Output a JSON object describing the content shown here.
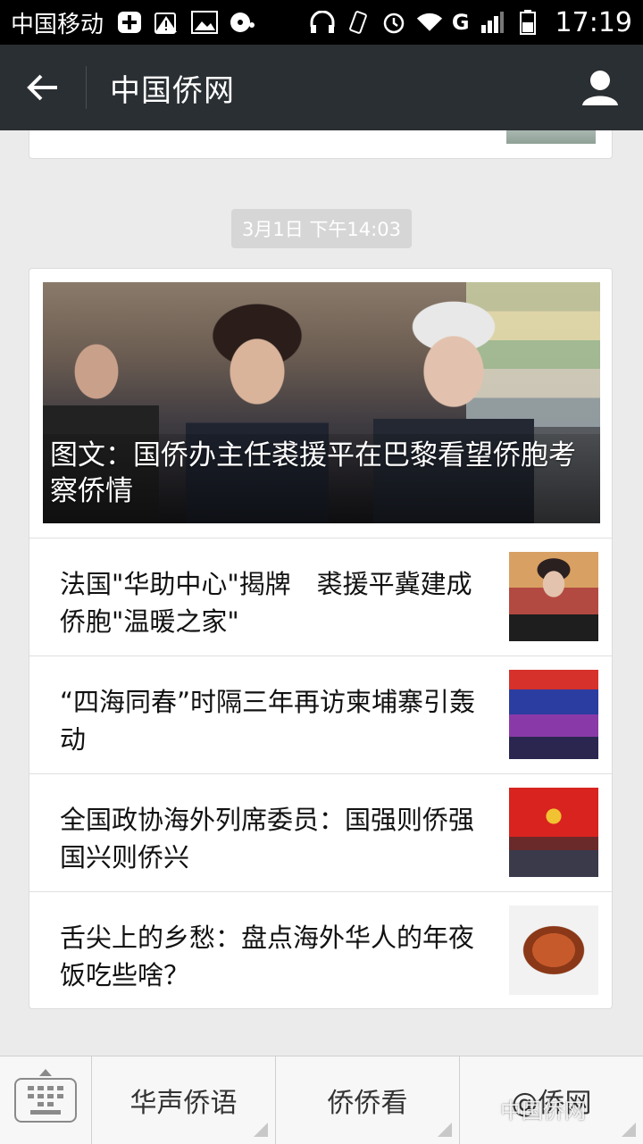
{
  "status_bar": {
    "carrier": "中国移动",
    "network": "G",
    "time": "17:19"
  },
  "header": {
    "title": "中国侨网"
  },
  "timestamp": "3月1日 下午14:03",
  "news": {
    "headline": "图文：国侨办主任裘援平在巴黎看望侨胞考察侨情",
    "items": [
      {
        "title": "法国\"华助中心\"揭牌　裘援平冀建成侨胞\"温暖之家\""
      },
      {
        "title": "“四海同春”时隔三年再访柬埔寨引轰动"
      },
      {
        "title": "全国政协海外列席委员：国强则侨强 国兴则侨兴"
      },
      {
        "title": "舌尖上的乡愁：盘点海外华人的年夜饭吃些啥？"
      }
    ]
  },
  "bottom_menu": {
    "items": [
      {
        "label": "华声侨语"
      },
      {
        "label": "侨侨看"
      },
      {
        "label": "@侨网"
      }
    ]
  },
  "watermark": "中国侨网",
  "colors": {
    "header_bg": "#2a2f33",
    "status_bg": "#000000",
    "page_bg": "#ebebeb"
  }
}
